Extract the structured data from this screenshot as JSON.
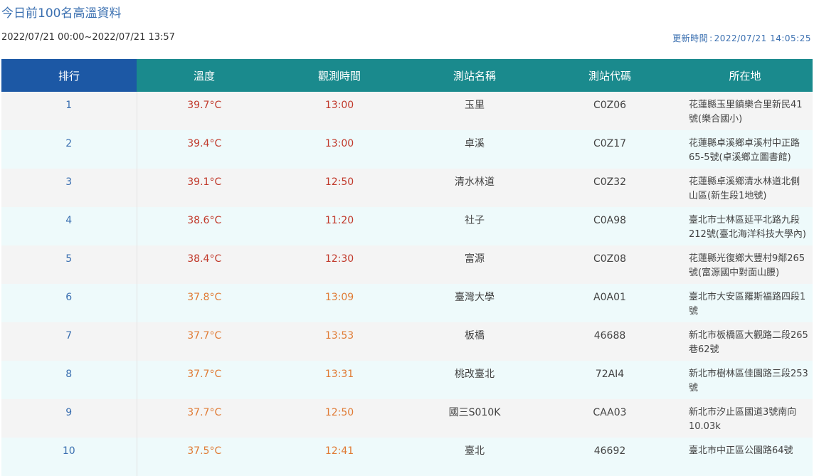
{
  "page": {
    "title": "今日前100名高溫資料",
    "date_range": "2022/07/21 00:00~2022/07/21 13:57",
    "update_label": "更新時間",
    "update_sep": ":",
    "update_value": "2022/07/21 14:05:25"
  },
  "table": {
    "headers": {
      "rank": "排行",
      "temp": "溫度",
      "time": "觀測時間",
      "station_name": "測站名稱",
      "station_code": "測站代碼",
      "location": "所在地"
    },
    "rows": [
      {
        "rank": "1",
        "temp": "39.7°C",
        "time": "13:00",
        "station_name": "玉里",
        "station_code": "C0Z06",
        "location": "花蓮縣玉里鎮樂合里新民41號(樂合國小)",
        "level": "hot"
      },
      {
        "rank": "2",
        "temp": "39.4°C",
        "time": "13:00",
        "station_name": "卓溪",
        "station_code": "C0Z17",
        "location": "花蓮縣卓溪鄉卓溪村中正路65-5號(卓溪鄉立圖書館)",
        "level": "hot"
      },
      {
        "rank": "3",
        "temp": "39.1°C",
        "time": "12:50",
        "station_name": "清水林道",
        "station_code": "C0Z32",
        "location": "花蓮縣卓溪鄉清水林道北側山區(新生段1地號)",
        "level": "hot"
      },
      {
        "rank": "4",
        "temp": "38.6°C",
        "time": "11:20",
        "station_name": "社子",
        "station_code": "C0A98",
        "location": "臺北市士林區延平北路九段212號(臺北海洋科技大學內)",
        "level": "hot"
      },
      {
        "rank": "5",
        "temp": "38.4°C",
        "time": "12:30",
        "station_name": "富源",
        "station_code": "C0Z08",
        "location": "花蓮縣光復鄉大豐村9鄰265號(富源國中對面山腰)",
        "level": "hot"
      },
      {
        "rank": "6",
        "temp": "37.8°C",
        "time": "13:09",
        "station_name": "臺灣大學",
        "station_code": "A0A01",
        "location": "臺北市大安區羅斯福路四段1號",
        "level": "warm"
      },
      {
        "rank": "7",
        "temp": "37.7°C",
        "time": "13:53",
        "station_name": "板橋",
        "station_code": "46688",
        "location": "新北市板橋區大觀路二段265巷62號",
        "level": "warm"
      },
      {
        "rank": "8",
        "temp": "37.7°C",
        "time": "13:31",
        "station_name": "桃改臺北",
        "station_code": "72AI4",
        "location": "新北市樹林區佳園路三段253號",
        "level": "warm"
      },
      {
        "rank": "9",
        "temp": "37.7°C",
        "time": "12:50",
        "station_name": "國三S010K",
        "station_code": "CAA03",
        "location": "新北市汐止區國道3號南向10.03k",
        "level": "warm"
      },
      {
        "rank": "10",
        "temp": "37.5°C",
        "time": "12:41",
        "station_name": "臺北",
        "station_code": "46692",
        "location": "臺北市中正區公園路64號",
        "level": "warm"
      }
    ]
  }
}
